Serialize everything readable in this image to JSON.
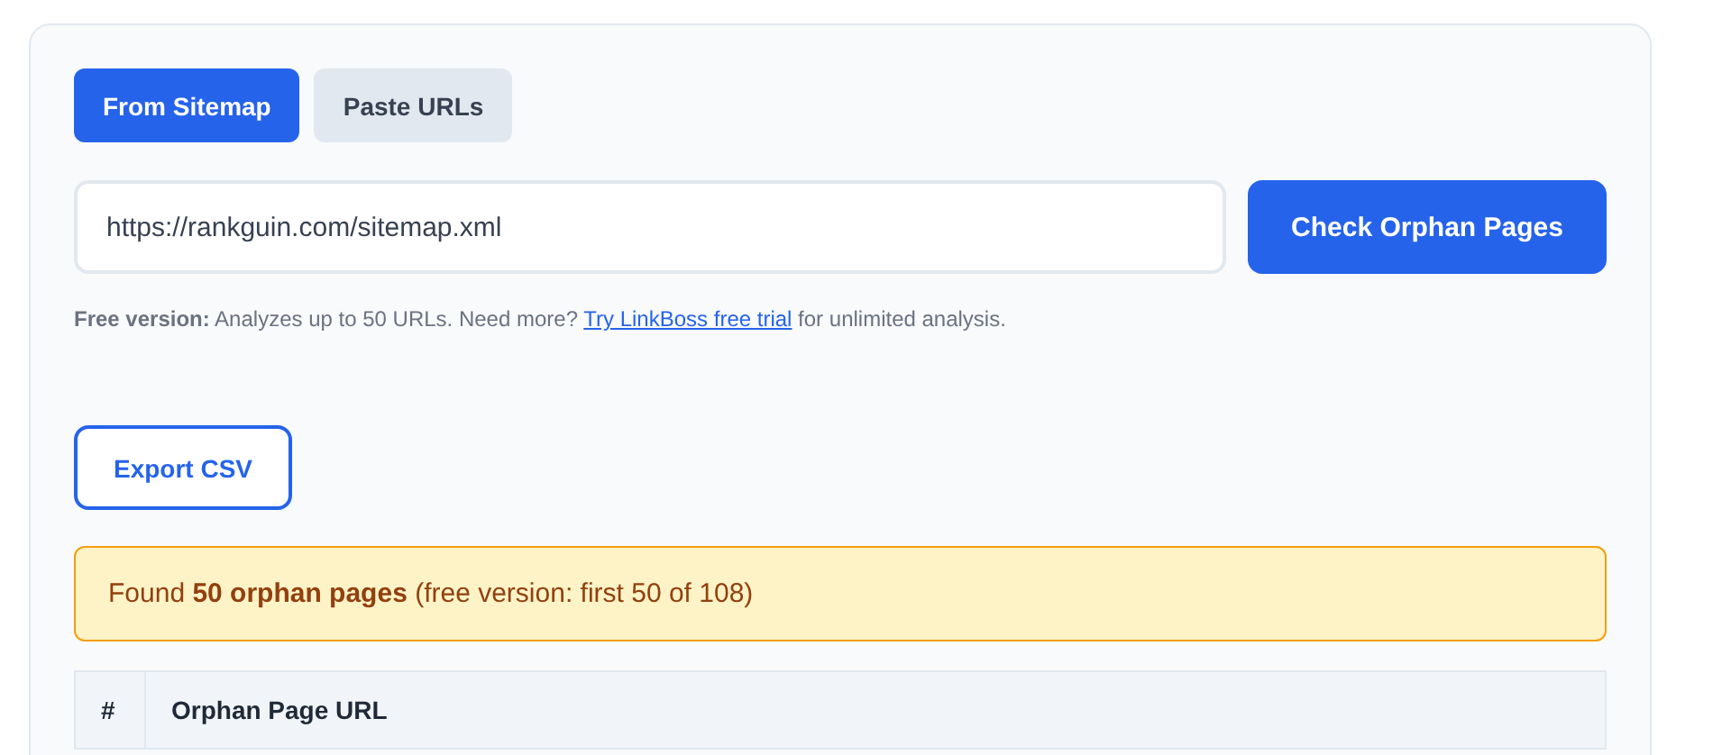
{
  "tabs": [
    {
      "label": "From Sitemap",
      "selected": true
    },
    {
      "label": "Paste URLs",
      "selected": false
    }
  ],
  "sitemap_field": {
    "value": "https://rankguin.com/sitemap.xml"
  },
  "check_button": "Check Orphan Pages",
  "note": {
    "text": "**Free version:** Analyzes up to 50 URLs. Need more?",
    "link": "Try LinkBoss free trial",
    "suffix": "for unlimited analysis."
  },
  "export_button": "Export CSV",
  "notice": "Found **50 orphan pages** (free version: first 50 of 108)",
  "table": {
    "columns": [
      "#",
      "Orphan Page URL"
    ]
  }
}
